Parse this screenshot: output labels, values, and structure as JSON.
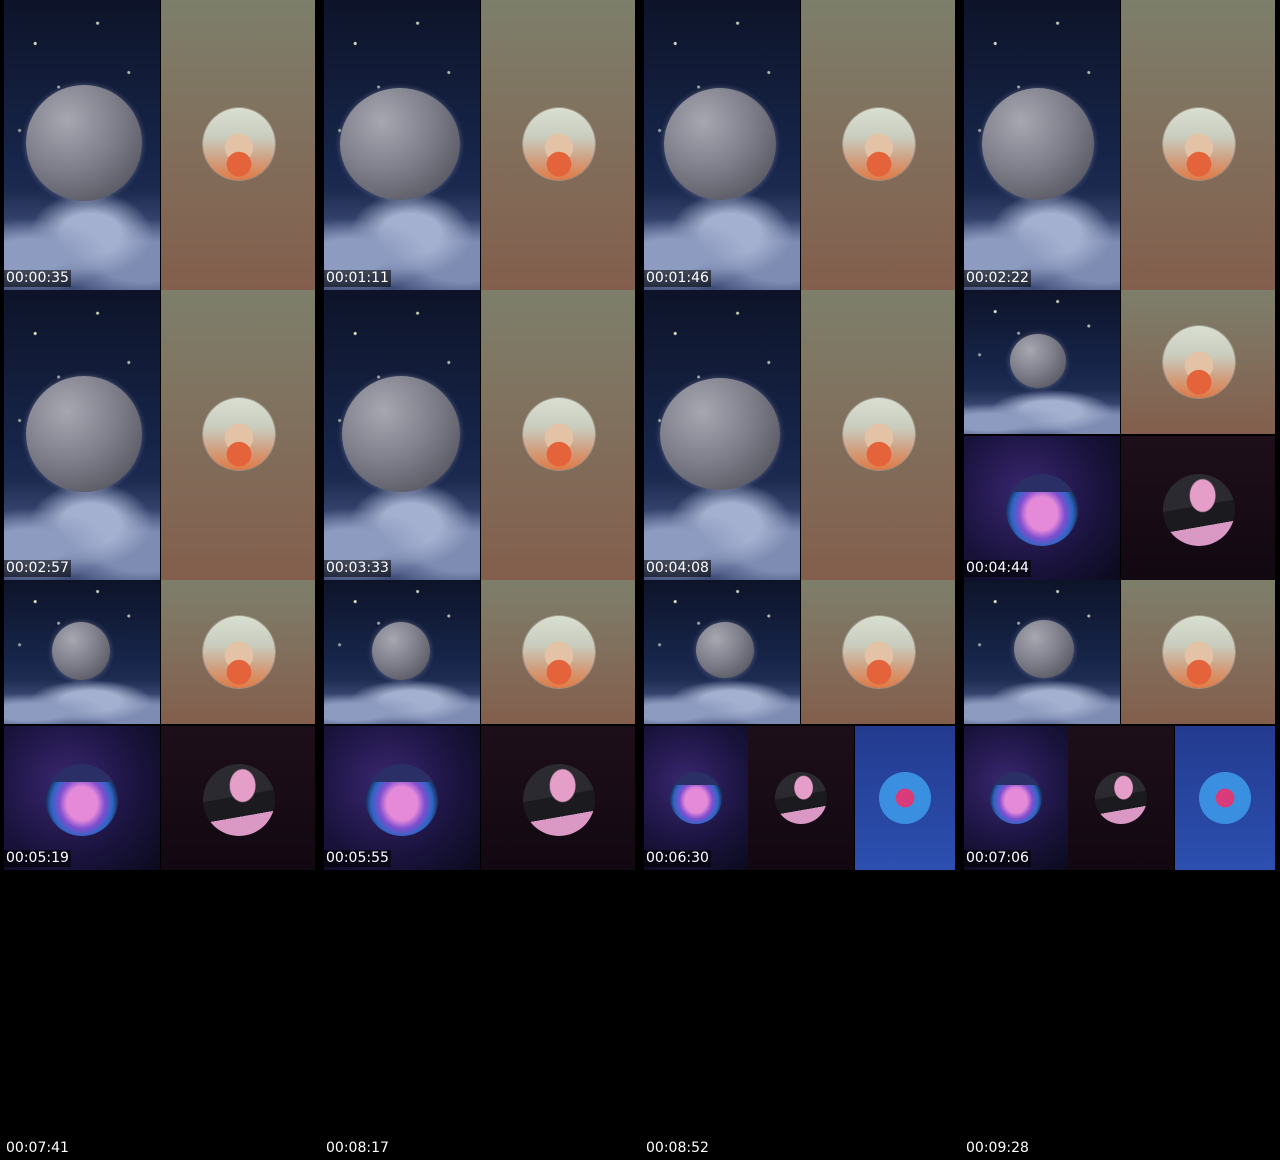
{
  "contact_sheet": {
    "timestamps": [
      "00:00:35",
      "00:01:11",
      "00:01:46",
      "00:02:22",
      "00:02:57",
      "00:03:33",
      "00:04:08",
      "00:04:44",
      "00:05:19",
      "00:05:55",
      "00:06:30",
      "00:07:06",
      "00:07:41",
      "00:08:17",
      "00:08:52",
      "00:09:28"
    ]
  }
}
